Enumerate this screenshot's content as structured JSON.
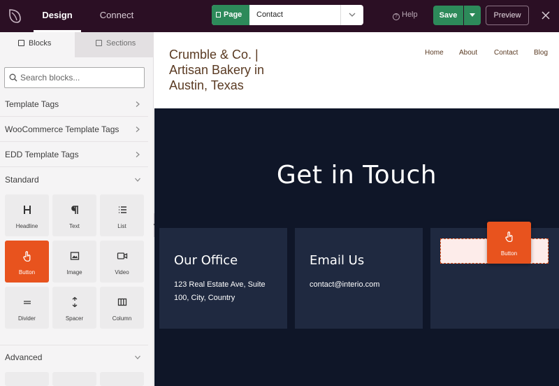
{
  "topbar": {
    "tabs": [
      {
        "label": "Design"
      },
      {
        "label": "Connect"
      }
    ],
    "page_badge": "Page",
    "page_value": "Contact",
    "help": "Help",
    "save": "Save",
    "preview": "Preview"
  },
  "sidebar": {
    "tabs": [
      {
        "label": "Blocks"
      },
      {
        "label": "Sections"
      }
    ],
    "search_placeholder": "Search blocks...",
    "groups": [
      {
        "label": "Template Tags"
      },
      {
        "label": "WooCommerce Template Tags"
      },
      {
        "label": "EDD Template Tags"
      },
      {
        "label": "Standard"
      },
      {
        "label": "Advanced"
      }
    ],
    "blocks": [
      {
        "label": "Headline",
        "icon": "headline-icon"
      },
      {
        "label": "Text",
        "icon": "paragraph-icon"
      },
      {
        "label": "List",
        "icon": "list-icon"
      },
      {
        "label": "Button",
        "icon": "pointer-hand-icon"
      },
      {
        "label": "Image",
        "icon": "image-icon"
      },
      {
        "label": "Video",
        "icon": "video-icon"
      },
      {
        "label": "Divider",
        "icon": "divider-icon"
      },
      {
        "label": "Spacer",
        "icon": "spacer-icon"
      },
      {
        "label": "Column",
        "icon": "column-icon"
      }
    ]
  },
  "canvas": {
    "site_title": "Crumble & Co. | Artisan Bakery in Austin, Texas",
    "nav": [
      {
        "label": "Home"
      },
      {
        "label": "About"
      },
      {
        "label": "Contact"
      },
      {
        "label": "Blog"
      }
    ],
    "hero_title": "Get in Touch",
    "cards": [
      {
        "title": "Our Office",
        "body": "123 Real Estate Ave, Suite 100, City, Country"
      },
      {
        "title": "Email Us",
        "body": "contact@interio.com"
      }
    ],
    "drag_label": "Button"
  },
  "colors": {
    "topbar": "#2b0f24",
    "accent_green": "#2d8a5a",
    "accent_orange": "#e8531e",
    "canvas_dark": "#0f1628",
    "card": "#1f2940"
  }
}
